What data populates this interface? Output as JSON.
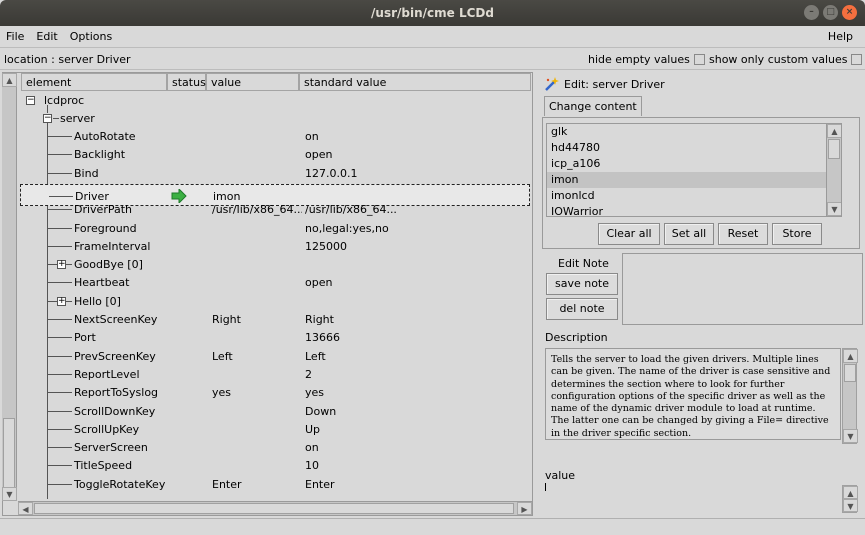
{
  "window": {
    "title": "/usr/bin/cme LCDd"
  },
  "menu": {
    "file": "File",
    "edit": "Edit",
    "options": "Options",
    "help": "Help"
  },
  "location": {
    "text": "location : server Driver",
    "hide_empty": "hide empty values",
    "show_custom": "show only custom values"
  },
  "tree": {
    "headers": {
      "element": "element",
      "status": "status",
      "value": "value",
      "standard": "standard value"
    },
    "root": "lcdproc",
    "server": "server",
    "rows": [
      {
        "element": "AutoRotate",
        "value": "",
        "standard": "on"
      },
      {
        "element": "Backlight",
        "value": "",
        "standard": "open"
      },
      {
        "element": "Bind",
        "value": "",
        "standard": "127.0.0.1"
      },
      {
        "element": "Driver",
        "value": "imon",
        "standard": ""
      },
      {
        "element": "DriverPath",
        "value": "/usr/lib/x86_64...",
        "standard": "/usr/lib/x86_64..."
      },
      {
        "element": "Foreground",
        "value": "",
        "standard": "no,legal:yes,no"
      },
      {
        "element": "FrameInterval",
        "value": "",
        "standard": "125000"
      },
      {
        "element": "GoodBye [0]",
        "value": "",
        "standard": ""
      },
      {
        "element": "Heartbeat",
        "value": "",
        "standard": "open"
      },
      {
        "element": "Hello [0]",
        "value": "",
        "standard": ""
      },
      {
        "element": "NextScreenKey",
        "value": "Right",
        "standard": "Right"
      },
      {
        "element": "Port",
        "value": "",
        "standard": "13666"
      },
      {
        "element": "PrevScreenKey",
        "value": "Left",
        "standard": "Left"
      },
      {
        "element": "ReportLevel",
        "value": "",
        "standard": "2"
      },
      {
        "element": "ReportToSyslog",
        "value": "yes",
        "standard": "yes"
      },
      {
        "element": "ScrollDownKey",
        "value": "",
        "standard": "Down"
      },
      {
        "element": "ScrollUpKey",
        "value": "",
        "standard": "Up"
      },
      {
        "element": "ServerScreen",
        "value": "",
        "standard": "on"
      },
      {
        "element": "TitleSpeed",
        "value": "",
        "standard": "10"
      },
      {
        "element": "ToggleRotateKey",
        "value": "Enter",
        "standard": "Enter"
      }
    ]
  },
  "editor": {
    "title": "Edit: server Driver",
    "tab": "Change content",
    "choices": [
      "glk",
      "hd44780",
      "icp_a106",
      "imon",
      "imonlcd",
      "IOWarrior"
    ],
    "buttons": {
      "clear_all": "Clear all",
      "set_all": "Set all",
      "reset": "Reset",
      "store": "Store"
    },
    "note_label": "Edit Note",
    "save_note": "save note",
    "del_note": "del note",
    "description_label": "Description",
    "description": "Tells the server to load the given drivers. Multiple lines can be given. The name of the driver is case sensitive and determines the section where to look for further configuration options of the specific driver as well as the name of the dynamic driver module to load at runtime. The latter one can be changed by giving a File= directive in the driver specific section.",
    "value_label": "value"
  }
}
